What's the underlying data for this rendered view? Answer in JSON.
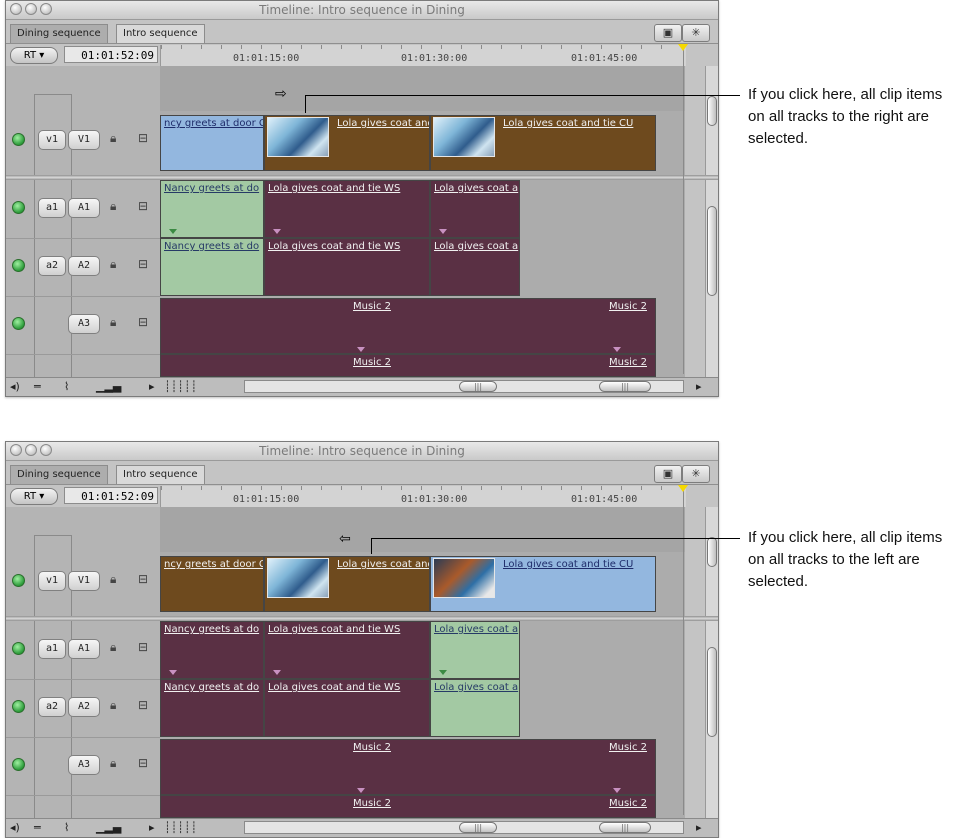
{
  "window": {
    "title": "Timeline: Intro sequence in Dining"
  },
  "tabs": [
    "Dining sequence",
    "Intro sequence"
  ],
  "timecode": "01:01:52:09",
  "rt_label": "RT ▾",
  "ruler": [
    "01:01:15:00",
    "01:01:30:00",
    "01:01:45:00"
  ],
  "tracks": {
    "v1": {
      "src": "v1",
      "dst": "V1"
    },
    "a1": {
      "src": "a1",
      "dst": "A1"
    },
    "a2": {
      "src": "a2",
      "dst": "A2"
    },
    "a3": {
      "dst": "A3"
    }
  },
  "panel1": {
    "clips": {
      "v1_a": "ncy greets at door C",
      "v1_b": "Lola gives coat and",
      "v1_c": "Lola gives coat and tie CU",
      "a1_a": "Nancy greets at do",
      "a1_b": "Lola gives coat and tie WS",
      "a1_c": "Lola gives coat a",
      "a2_a": "Nancy greets at do",
      "a2_b": "Lola gives coat and tie WS",
      "a2_c": "Lola gives coat a",
      "a3_a": "Music 2",
      "a3_b": "Music 2",
      "a3_c": "Music 2",
      "a3_d": "Music 2"
    },
    "callout": "If you click here, all clip items on all tracks to the right are selected.",
    "cursor": "⇨"
  },
  "panel2": {
    "clips": {
      "v1_a": "ncy greets at door C",
      "v1_b": "Lola gives coat and",
      "v1_c": "Lola gives coat and tie CU",
      "a1_a": "Nancy greets at do",
      "a1_b": "Lola gives coat and tie WS",
      "a1_c": "Lola gives coat a",
      "a2_a": "Nancy greets at do",
      "a2_b": "Lola gives coat and tie WS",
      "a2_c": "Lola gives coat a",
      "a3_a": "Music 2",
      "a3_b": "Music 2",
      "a3_c": "Music 2",
      "a3_d": "Music 2"
    },
    "callout": "If you click here, all clip items on all tracks to the left are selected.",
    "cursor": "⇦"
  },
  "colors": {
    "video_blue": "#93b7df",
    "video_brown": "#6e4a1e",
    "audio_purple": "#5a3044",
    "audio_green": "#a3c9a3",
    "playhead_yellow": "#f5d800"
  }
}
